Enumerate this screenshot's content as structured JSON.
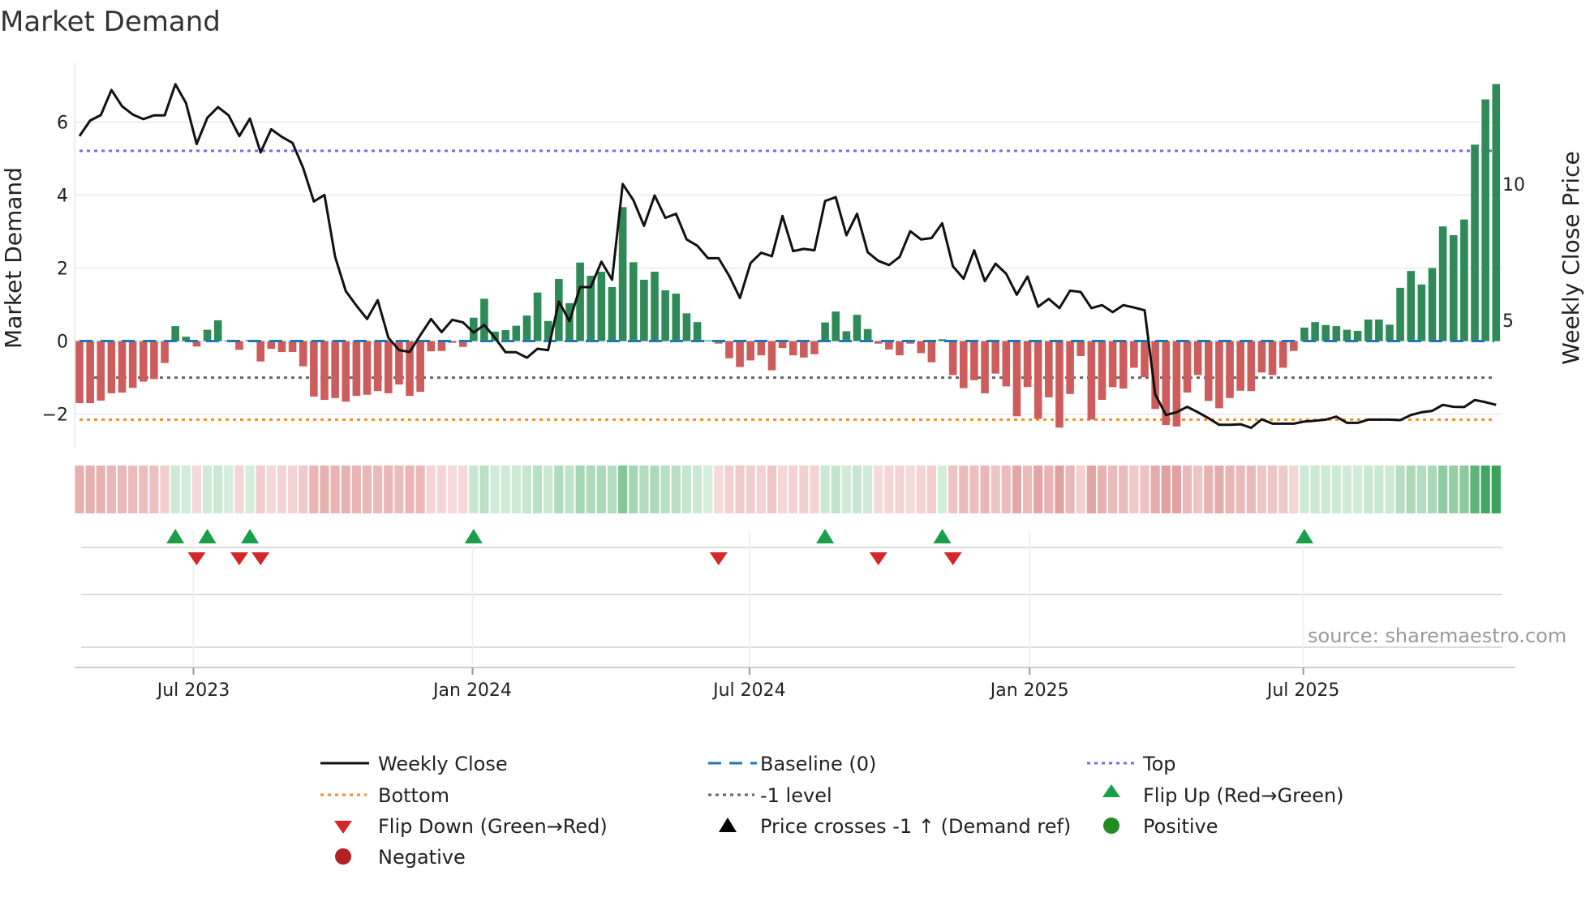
{
  "chart_data": {
    "type": "bar",
    "title": "Market Demand",
    "ylabel": "Market Demand",
    "y2label": "Weekly Close Price",
    "ylim": [
      -2.92,
      7.61
    ],
    "y2lim": [
      0.33,
      14.43
    ],
    "yticks": [
      {
        "v": 6,
        "label": "6"
      },
      {
        "v": 4,
        "label": "4"
      },
      {
        "v": 2,
        "label": "2"
      },
      {
        "v": 0,
        "label": "0"
      },
      {
        "v": -2,
        "label": "−2"
      }
    ],
    "y2ticks": [
      {
        "v": 10,
        "label": "10"
      },
      {
        "v": 5,
        "label": "5"
      }
    ],
    "xticks": [
      {
        "week": 11.7,
        "label": "Jul 2023"
      },
      {
        "week": 37.9,
        "label": "Jan 2024"
      },
      {
        "week": 63.9,
        "label": "Jul 2024"
      },
      {
        "week": 90.2,
        "label": "Jan 2025"
      },
      {
        "week": 115.9,
        "label": "Jul 2025"
      }
    ],
    "levels": {
      "top": 5.21,
      "baseline": 0,
      "minus_one": -1,
      "bottom": -2.15
    },
    "demand": [
      -1.7,
      -1.7,
      -1.63,
      -1.43,
      -1.41,
      -1.28,
      -1.11,
      -1.04,
      -0.6,
      0.41,
      0.12,
      -0.15,
      0.31,
      0.57,
      0.02,
      -0.24,
      0.03,
      -0.56,
      -0.21,
      -0.3,
      -0.3,
      -0.69,
      -1.52,
      -1.61,
      -1.56,
      -1.66,
      -1.5,
      -1.47,
      -1.37,
      -1.43,
      -1.19,
      -1.5,
      -1.39,
      -0.28,
      -0.27,
      -0.05,
      -0.16,
      0.64,
      1.16,
      0.26,
      0.3,
      0.42,
      0.7,
      1.33,
      0.55,
      1.7,
      1.04,
      2.15,
      1.79,
      1.9,
      1.48,
      3.67,
      2.16,
      1.68,
      1.9,
      1.39,
      1.3,
      0.76,
      0.52,
      0.02,
      -0.07,
      -0.47,
      -0.71,
      -0.53,
      -0.39,
      -0.8,
      -0.19,
      -0.39,
      -0.45,
      -0.36,
      0.51,
      0.81,
      0.27,
      0.72,
      0.33,
      -0.07,
      -0.23,
      -0.39,
      -0.07,
      -0.33,
      -0.58,
      0.05,
      -0.93,
      -1.29,
      -1.07,
      -1.43,
      -0.89,
      -1.24,
      -2.06,
      -1.26,
      -2.13,
      -1.54,
      -2.37,
      -1.45,
      -0.41,
      -2.15,
      -1.61,
      -1.26,
      -1.3,
      -0.73,
      -0.99,
      -1.86,
      -2.3,
      -2.34,
      -1.41,
      -0.93,
      -1.64,
      -1.84,
      -1.56,
      -1.36,
      -1.37,
      -0.86,
      -0.93,
      -0.73,
      -0.27,
      0.37,
      0.52,
      0.44,
      0.41,
      0.31,
      0.28,
      0.59,
      0.59,
      0.45,
      1.46,
      1.92,
      1.55,
      2.0,
      3.14,
      2.9,
      3.33,
      5.38,
      6.62,
      7.04
    ],
    "weekly_close": [
      11.76,
      12.33,
      12.53,
      13.45,
      12.85,
      12.55,
      12.38,
      12.52,
      12.52,
      13.66,
      12.97,
      11.47,
      12.43,
      12.82,
      12.52,
      11.76,
      12.4,
      11.16,
      12.01,
      11.73,
      11.51,
      10.59,
      9.36,
      9.6,
      7.33,
      6.07,
      5.54,
      5.05,
      5.74,
      4.36,
      3.91,
      3.84,
      4.46,
      5.05,
      4.57,
      5.02,
      4.93,
      4.55,
      4.83,
      4.36,
      3.83,
      3.83,
      3.63,
      3.96,
      3.91,
      5.69,
      4.97,
      6.22,
      6.22,
      7.15,
      6.49,
      10.0,
      9.41,
      8.47,
      9.58,
      8.76,
      8.91,
      7.97,
      7.74,
      7.28,
      7.28,
      6.63,
      5.82,
      7.1,
      7.48,
      7.35,
      8.83,
      7.54,
      7.62,
      7.57,
      9.38,
      9.52,
      8.12,
      8.91,
      7.5,
      7.18,
      7.03,
      7.33,
      8.27,
      7.97,
      8.02,
      8.56,
      6.98,
      6.53,
      7.57,
      6.44,
      7.08,
      6.71,
      5.94,
      6.61,
      5.5,
      5.79,
      5.45,
      6.09,
      6.04,
      5.45,
      5.56,
      5.3,
      5.56,
      5.47,
      5.37,
      2.28,
      1.53,
      1.63,
      1.83,
      1.63,
      1.41,
      1.17,
      1.17,
      1.19,
      1.06,
      1.37,
      1.21,
      1.21,
      1.21,
      1.29,
      1.32,
      1.36,
      1.47,
      1.24,
      1.24,
      1.36,
      1.36,
      1.36,
      1.34,
      1.53,
      1.63,
      1.68,
      1.9,
      1.83,
      1.82,
      2.08,
      2.0,
      1.9
    ],
    "legend": {
      "weekly_close": "Weekly Close",
      "baseline": "Baseline (0)",
      "top": "Top",
      "bottom": "Bottom",
      "minus_one": "-1 level",
      "flip_up": "Flip Up (Red→Green)",
      "flip_down": "Flip Down (Green→Red)",
      "price_cross": "Price crosses -1 ↑ (Demand ref)",
      "positive": "Positive",
      "negative": "Negative"
    },
    "source": "source: sharemaestro.com",
    "colors": {
      "pos_bar": "#2e8b57",
      "neg_bar": "#cd5c5c",
      "line": "#111111",
      "baseline": "#1f77b4",
      "top": "#7b68ee",
      "bottom": "#ff8c1a",
      "minus_one": "#666666",
      "flip_up": "#1a9e4a",
      "flip_down": "#d62728",
      "positive": "#228b22",
      "negative": "#b22222"
    }
  }
}
